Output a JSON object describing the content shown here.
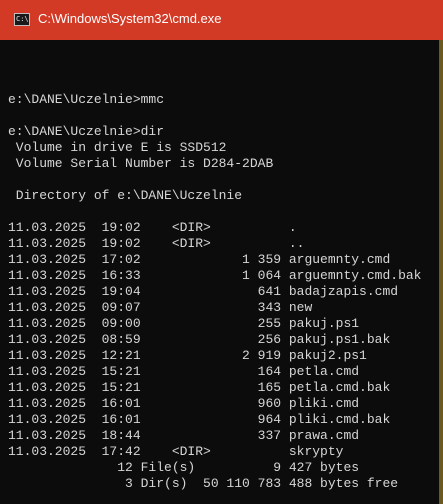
{
  "window": {
    "title": "C:\\Windows\\System32\\cmd.exe",
    "icon": "cmd-icon",
    "icon_text": "C:\\"
  },
  "console": {
    "lines": [
      "",
      "e:\\DANE\\Uczelnie>mmc",
      "",
      "e:\\DANE\\Uczelnie>dir",
      " Volume in drive E is SSD512",
      " Volume Serial Number is D284-2DAB",
      "",
      " Directory of e:\\DANE\\Uczelnie",
      "",
      "11.03.2025  19:02    <DIR>          .",
      "11.03.2025  19:02    <DIR>          ..",
      "11.03.2025  17:02             1 359 arguemnty.cmd",
      "11.03.2025  16:33             1 064 arguemnty.cmd.bak",
      "11.03.2025  19:04               641 badajzapis.cmd",
      "11.03.2025  09:07               343 new",
      "11.03.2025  09:00               255 pakuj.ps1",
      "11.03.2025  08:59               256 pakuj.ps1.bak",
      "11.03.2025  12:21             2 919 pakuj2.ps1",
      "11.03.2025  15:21               164 petla.cmd",
      "11.03.2025  15:21               165 petla.cmd.bak",
      "11.03.2025  16:01               960 pliki.cmd",
      "11.03.2025  16:01               964 pliki.cmd.bak",
      "11.03.2025  18:44               337 prawa.cmd",
      "11.03.2025  17:42    <DIR>          skrypty",
      "              12 File(s)          9 427 bytes",
      "               3 Dir(s)  50 110 783 488 bytes free",
      ""
    ],
    "prompt": "e:\\DANE\\Uczelnie>"
  },
  "colors": {
    "titlebar": "#d23a26",
    "background": "#0c0c0c",
    "text": "#d6d6d6"
  }
}
